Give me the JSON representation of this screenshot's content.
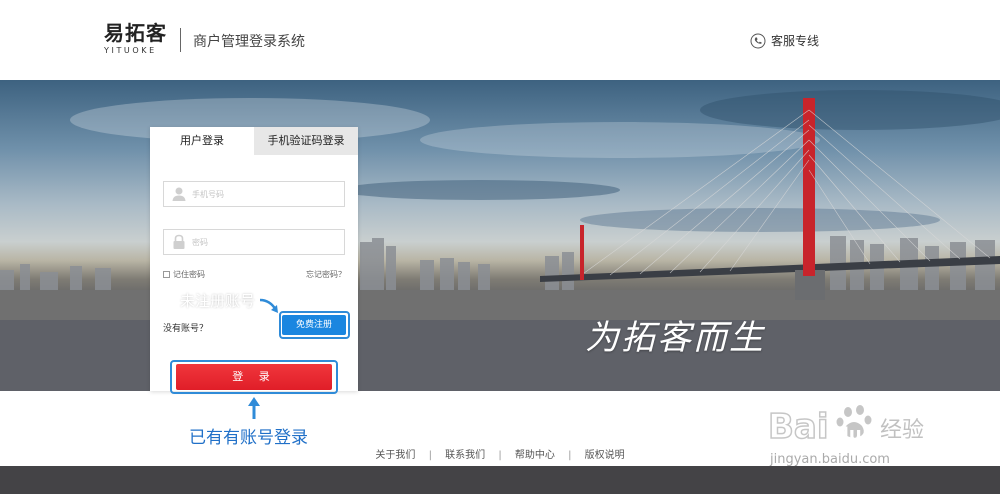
{
  "header": {
    "logo_cn": "易拓客",
    "logo_en": "YITUOKE",
    "system_title": "商户管理登录系统",
    "service_label": "客服专线"
  },
  "banner": {
    "slogan": "为拓客而生"
  },
  "login": {
    "tabs": [
      {
        "label": "用户登录",
        "active": true
      },
      {
        "label": "手机验证码登录",
        "active": false
      }
    ],
    "phone_placeholder": "手机号码",
    "password_placeholder": "密码",
    "remember_label": "记住密码",
    "forgot_label": "忘记密码？",
    "no_account_label": "没有账号？",
    "register_label": "免费注册",
    "login_label": "登 录"
  },
  "annotations": {
    "register_hint": "未注册账号",
    "login_hint": "已有有账号登录"
  },
  "footer": {
    "links": [
      "关于我们",
      "联系我们",
      "帮助中心",
      "版权说明"
    ],
    "separator": "|"
  },
  "watermark": {
    "brand": "Bai du 经验",
    "url": "jingyan.baidu.com"
  },
  "colors": {
    "accent_blue": "#1a86e0",
    "login_red": "#e01e28",
    "annotation_blue": "#2f8bd8",
    "footer_bar": "#444346"
  }
}
